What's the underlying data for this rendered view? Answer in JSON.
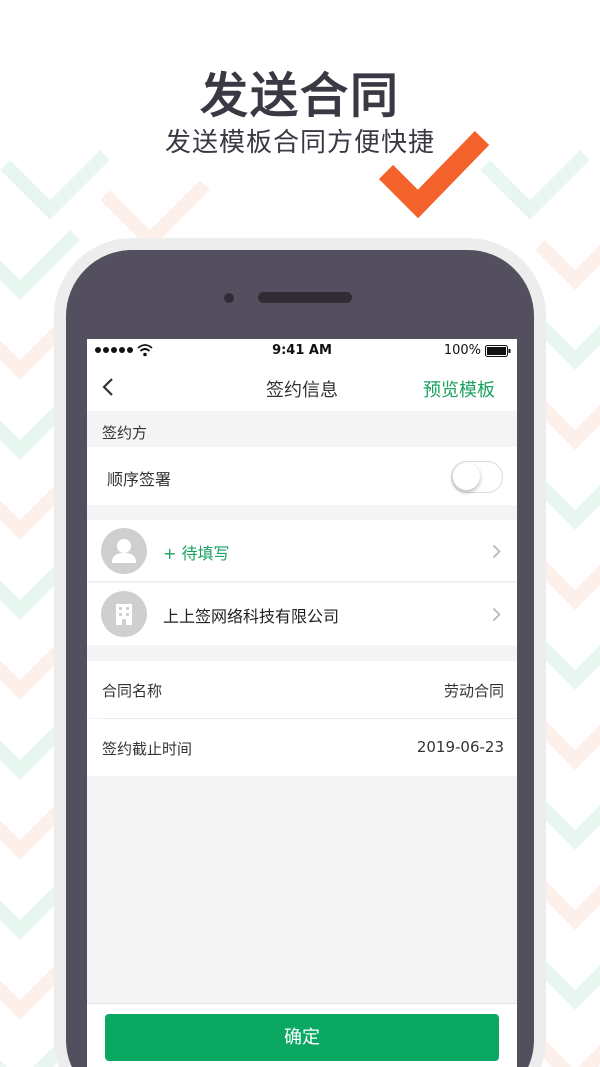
{
  "promo": {
    "title": "发送合同",
    "subtitle": "发送模板合同方便快捷"
  },
  "status_bar": {
    "time": "9:41 AM",
    "battery": "100%"
  },
  "nav": {
    "title": "签约信息",
    "action": "预览模板"
  },
  "signer_section": {
    "label": "签约方",
    "sequence_label": "顺序签署",
    "sequence_enabled": false
  },
  "parties": [
    {
      "label": "+ 待填写",
      "icon": "person-avatar-icon"
    },
    {
      "label": "上上签网络科技有限公司",
      "icon": "building-icon"
    }
  ],
  "contract_info": {
    "name_label": "合同名称",
    "name_value": "劳动合同",
    "deadline_label": "签约截止时间",
    "deadline_value": "2019-06-23"
  },
  "confirm_label": "确定",
  "colors": {
    "accent_green": "#1aa260",
    "button_green": "#0ba863",
    "check_orange": "#f4622c",
    "phone_body": "#544f5e"
  }
}
